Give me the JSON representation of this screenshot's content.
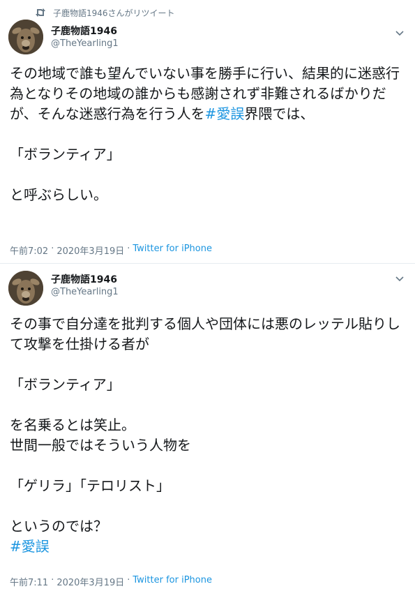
{
  "retweet": {
    "label": "子鹿物語1946さんがリツイート"
  },
  "tweets": [
    {
      "display_name": "子鹿物語1946",
      "handle": "@TheYearling1",
      "paragraph_1": "その地域で誰も望んでいない事を勝手に行い、結果的に迷惑行為となりその地域の誰からも感謝されず非難されるばかりだが、そんな迷惑行為を行う人を",
      "hashtag_inline": "#愛誤",
      "paragraph_1_tail": "界隈では、",
      "line_quote": "「ボランティア」",
      "line_end": "と呼ぶらしい。",
      "time": "午前7:02",
      "date": "2020年3月19日",
      "source": "Twitter for iPhone"
    },
    {
      "display_name": "子鹿物語1946",
      "handle": "@TheYearling1",
      "paragraph_1": "その事で自分達を批判する個人や団体には悪のレッテル貼りして攻撃を仕掛ける者が",
      "line_quote": "「ボランティア」",
      "line_2": "を名乗るとは笑止。",
      "line_3": "世間一般ではそういう人物を",
      "line_quote_2": "「ゲリラ」「テロリスト」",
      "line_end": "というのでは？",
      "hashtag": "#愛誤",
      "time": "午前7:11",
      "date": "2020年3月19日",
      "source": "Twitter for iPhone"
    }
  ],
  "separator": "·",
  "colors": {
    "link": "#1b95e0",
    "secondary": "#657786",
    "text": "#14171a"
  },
  "icons": {
    "retweet": "retweet-icon",
    "avatar": "deer-avatar",
    "chevron": "chevron-down-icon"
  }
}
